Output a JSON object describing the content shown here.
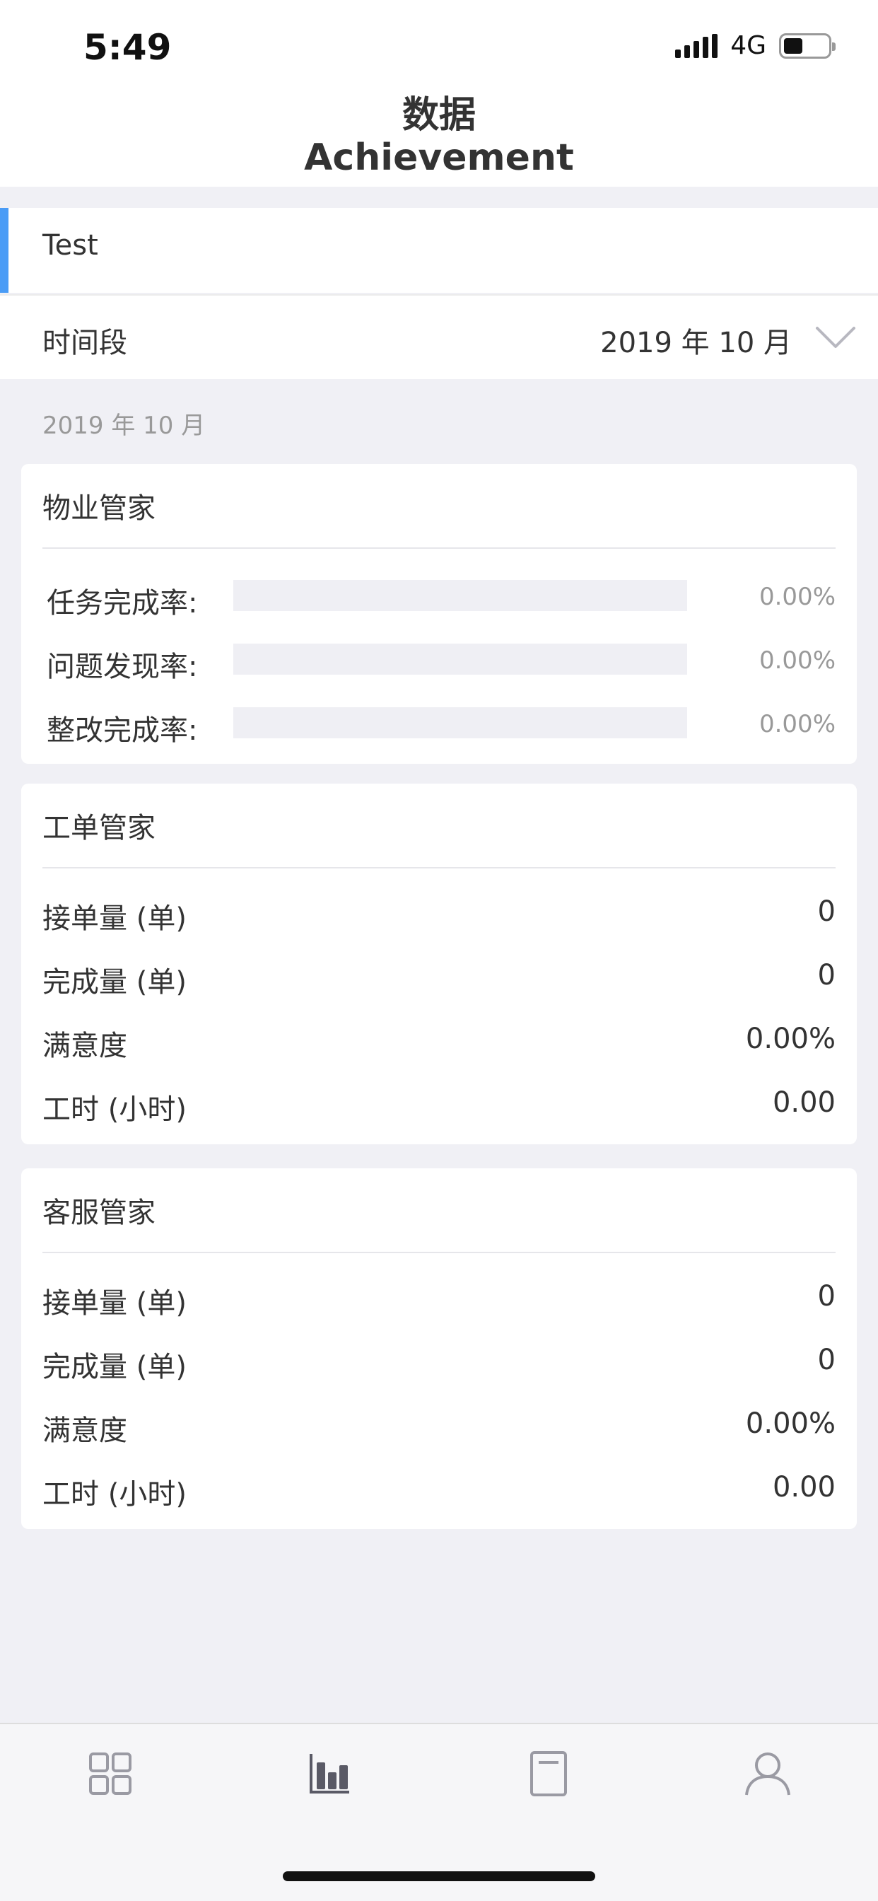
{
  "status_bar": {
    "time": "5:49",
    "network": "4G"
  },
  "header": {
    "title_cn": "数据",
    "title_en": "Achievement"
  },
  "project": {
    "name": "Test",
    "accent_color": "#4a9cf6"
  },
  "period": {
    "label": "时间段",
    "value": "2019 年 10 月"
  },
  "date_caption": "2019 年 10 月",
  "property_card": {
    "title": "物业管家",
    "rows": [
      {
        "label": "任务完成率:",
        "value": "0.00%",
        "fraction": 0
      },
      {
        "label": "问题发现率:",
        "value": "0.00%",
        "fraction": 0
      },
      {
        "label": "整改完成率:",
        "value": "0.00%",
        "fraction": 0
      }
    ]
  },
  "workorder_card": {
    "title": "工单管家",
    "rows": [
      {
        "label": "接单量 (单)",
        "value": "0"
      },
      {
        "label": "完成量 (单)",
        "value": "0"
      },
      {
        "label": "满意度",
        "value": "0.00%"
      },
      {
        "label": "工时 (小时)",
        "value": "0.00"
      }
    ]
  },
  "service_card": {
    "title": "客服管家",
    "rows": [
      {
        "label": "接单量 (单)",
        "value": "0"
      },
      {
        "label": "完成量 (单)",
        "value": "0"
      },
      {
        "label": "满意度",
        "value": "0.00%"
      },
      {
        "label": "工时 (小时)",
        "value": "0.00"
      }
    ]
  },
  "tabbar": {
    "tabs": [
      {
        "icon": "grid-icon",
        "active": false
      },
      {
        "icon": "bar-chart-icon",
        "active": true
      },
      {
        "icon": "document-icon",
        "active": false
      },
      {
        "icon": "person-icon",
        "active": false
      }
    ],
    "active_color": "#5a5a66",
    "inactive_color": "#9a9aa3"
  }
}
